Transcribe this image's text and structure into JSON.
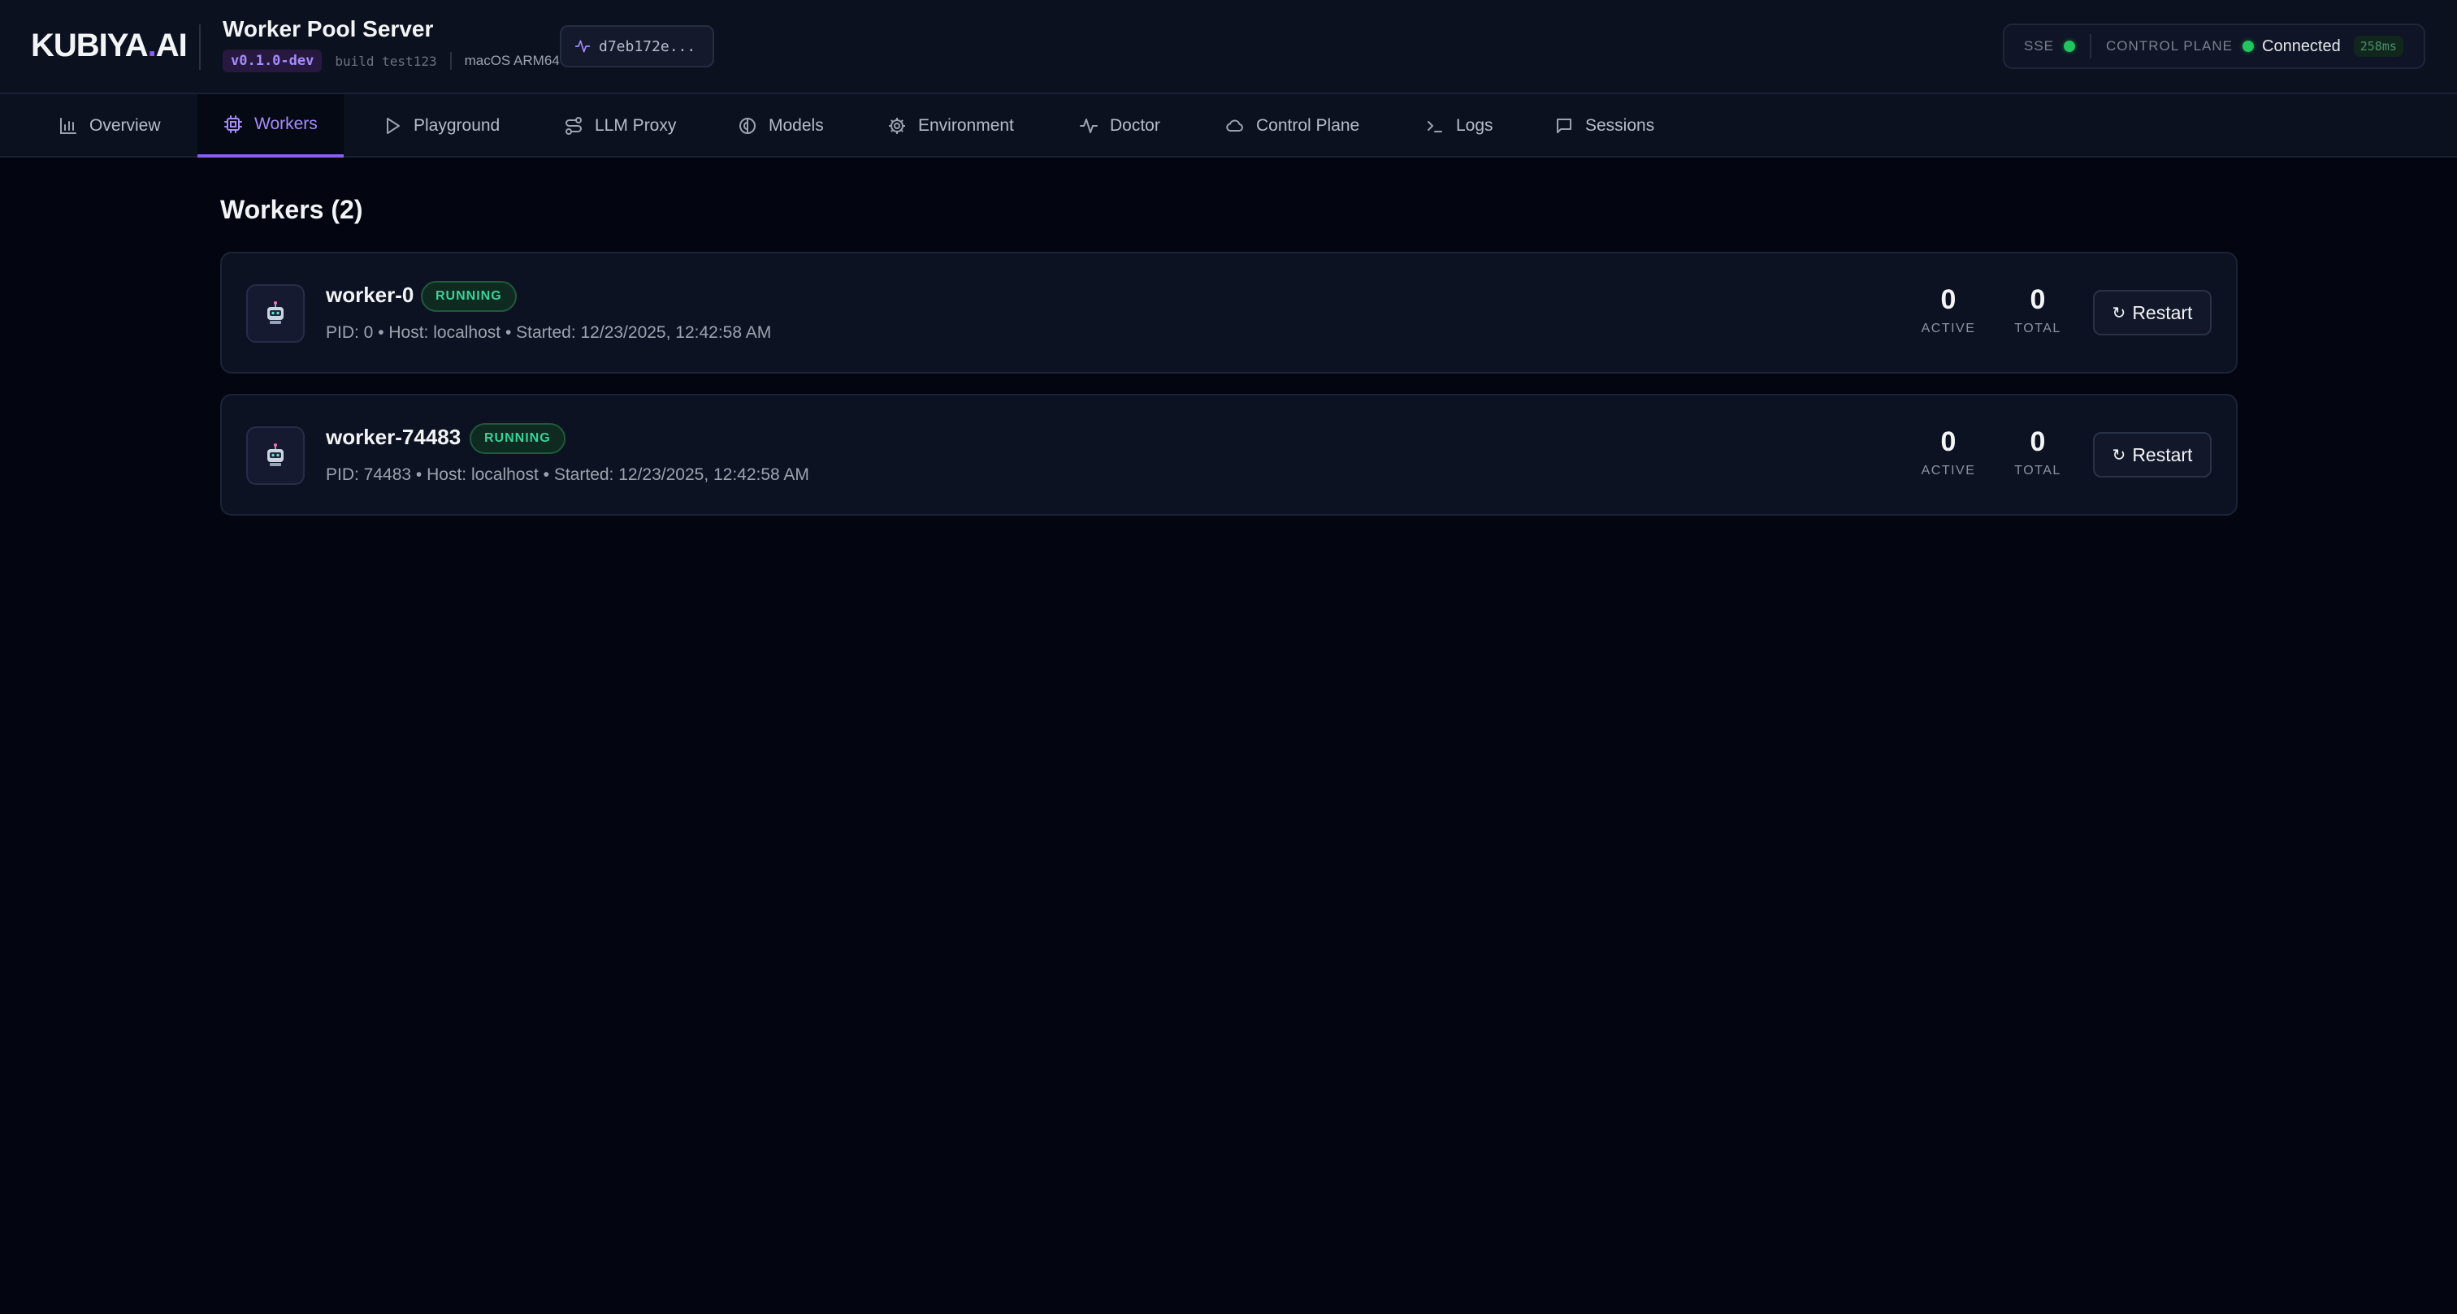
{
  "header": {
    "logo_main": "KUBIYA",
    "logo_dot": ".",
    "logo_suffix": "AI",
    "title": "Worker Pool Server",
    "version": "v0.1.0-dev",
    "build": "build test123",
    "platform": "macOS ARM64",
    "commit": "d7eb172e...",
    "status": {
      "sse_label": "SSE",
      "control_plane_label": "CONTROL PLANE",
      "connection": "Connected",
      "latency": "258ms"
    }
  },
  "nav": {
    "tabs": [
      {
        "label": "Overview",
        "icon": "bar-chart-icon"
      },
      {
        "label": "Workers",
        "icon": "cpu-icon",
        "active": true
      },
      {
        "label": "Playground",
        "icon": "play-icon"
      },
      {
        "label": "LLM Proxy",
        "icon": "route-icon"
      },
      {
        "label": "Models",
        "icon": "brain-icon"
      },
      {
        "label": "Environment",
        "icon": "gear-icon"
      },
      {
        "label": "Doctor",
        "icon": "activity-icon"
      },
      {
        "label": "Control Plane",
        "icon": "cloud-icon"
      },
      {
        "label": "Logs",
        "icon": "terminal-icon"
      },
      {
        "label": "Sessions",
        "icon": "chat-icon"
      }
    ]
  },
  "main": {
    "title": "Workers (2)",
    "workers": [
      {
        "name": "worker-0",
        "status": "RUNNING",
        "meta": "PID: 0 • Host: localhost • Started: 12/23/2025, 12:42:58 AM",
        "active": "0",
        "active_label": "ACTIVE",
        "total": "0",
        "total_label": "TOTAL",
        "restart_label": "Restart"
      },
      {
        "name": "worker-74483",
        "status": "RUNNING",
        "meta": "PID: 74483 • Host: localhost • Started: 12/23/2025, 12:42:58 AM",
        "active": "0",
        "active_label": "ACTIVE",
        "total": "0",
        "total_label": "TOTAL",
        "restart_label": "Restart"
      }
    ]
  },
  "colors": {
    "accent": "#8b5cf6",
    "running": "#34d399",
    "connected": "#22c55e",
    "background": "#030611"
  }
}
